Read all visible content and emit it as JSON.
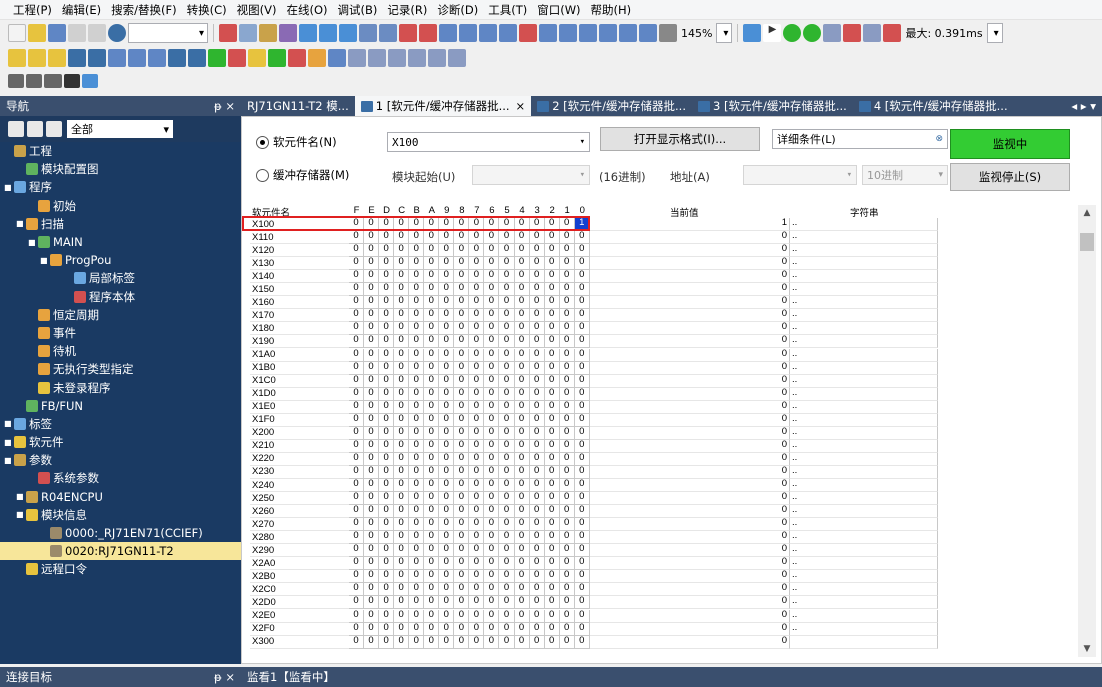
{
  "menu": [
    "工程(P)",
    "编辑(E)",
    "搜索/替换(F)",
    "转换(C)",
    "视图(V)",
    "在线(O)",
    "调试(B)",
    "记录(R)",
    "诊断(D)",
    "工具(T)",
    "窗口(W)",
    "帮助(H)"
  ],
  "toolbar": {
    "zoom": "145%",
    "max_label": "最大: 0.391ms"
  },
  "nav": {
    "title": "导航",
    "pin": "ᵽ ×",
    "filter": "全部",
    "items": [
      {
        "label": "工程",
        "indent": 0,
        "exp": "",
        "icon": "#c9a24a"
      },
      {
        "label": "模块配置图",
        "indent": 1,
        "exp": "",
        "icon": "#5fb35f"
      },
      {
        "label": "程序",
        "indent": 0,
        "exp": "■",
        "icon": "#6aa7e0"
      },
      {
        "label": "初始",
        "indent": 2,
        "exp": "",
        "icon": "#e7a33e"
      },
      {
        "label": "扫描",
        "indent": 1,
        "exp": "■",
        "icon": "#e7a33e"
      },
      {
        "label": "MAIN",
        "indent": 2,
        "exp": "■",
        "icon": "#5fb35f"
      },
      {
        "label": "ProgPou",
        "indent": 3,
        "exp": "■",
        "icon": "#e7a33e"
      },
      {
        "label": "局部标签",
        "indent": 5,
        "exp": "",
        "icon": "#6aa7e0"
      },
      {
        "label": "程序本体",
        "indent": 5,
        "exp": "",
        "icon": "#d35050"
      },
      {
        "label": "恒定周期",
        "indent": 2,
        "exp": "",
        "icon": "#e7a33e"
      },
      {
        "label": "事件",
        "indent": 2,
        "exp": "",
        "icon": "#e7a33e"
      },
      {
        "label": "待机",
        "indent": 2,
        "exp": "",
        "icon": "#e7a33e"
      },
      {
        "label": "无执行类型指定",
        "indent": 2,
        "exp": "",
        "icon": "#e7a33e"
      },
      {
        "label": "未登录程序",
        "indent": 2,
        "exp": "",
        "icon": "#e7c33e"
      },
      {
        "label": "FB/FUN",
        "indent": 1,
        "exp": "",
        "icon": "#5fb35f"
      },
      {
        "label": "标签",
        "indent": 0,
        "exp": "■",
        "icon": "#6aa7e0"
      },
      {
        "label": "软元件",
        "indent": 0,
        "exp": "■",
        "icon": "#e7c33e"
      },
      {
        "label": "参数",
        "indent": 0,
        "exp": "■",
        "icon": "#c9a24a"
      },
      {
        "label": "系统参数",
        "indent": 2,
        "exp": "",
        "icon": "#d35050"
      },
      {
        "label": "R04ENCPU",
        "indent": 1,
        "exp": "■",
        "icon": "#c9a24a"
      },
      {
        "label": "模块信息",
        "indent": 1,
        "exp": "■",
        "icon": "#e7c33e"
      },
      {
        "label": "0000:_RJ71EN71(CCIEF)",
        "indent": 3,
        "exp": "",
        "icon": "#9b8a6a"
      },
      {
        "label": "0020:RJ71GN11-T2",
        "indent": 3,
        "exp": "",
        "icon": "#9b8a6a",
        "selected": true
      },
      {
        "label": "远程口令",
        "indent": 1,
        "exp": "",
        "icon": "#e7c33e"
      }
    ]
  },
  "tabs": [
    {
      "label": "RJ71GN11-T2 模...",
      "active": false
    },
    {
      "label": "1 [软元件/缓冲存储器批...",
      "active": true,
      "close": "×"
    },
    {
      "label": "2 [软元件/缓冲存储器批...",
      "active": false
    },
    {
      "label": "3 [软元件/缓冲存储器批...",
      "active": false
    },
    {
      "label": "4 [软元件/缓冲存储器批...",
      "active": false
    }
  ],
  "tab_arrows": "◂ ▸ ▾",
  "form": {
    "device_radio": "软元件名(N)",
    "device_value": "X100",
    "buffer_radio": "缓冲存储器(M)",
    "module_start": "模块起始(U)",
    "hex_label": "(16进制)",
    "address_label": "地址(A)",
    "radix_value": "10进制",
    "open_format": "打开显示格式(I)...",
    "detail_cond": "详细条件(L)",
    "monitoring": "监视中",
    "stop_monitor": "监视停止(S)"
  },
  "grid": {
    "col_name": "软元件名",
    "bit_headers": [
      "F",
      "E",
      "D",
      "C",
      "B",
      "A",
      "9",
      "8",
      "7",
      "6",
      "5",
      "4",
      "3",
      "2",
      "1",
      "0"
    ],
    "col_value": "当前值",
    "col_string": "字符串",
    "rows": [
      {
        "name": "X100",
        "value": "1",
        "str": "..",
        "hi": true
      },
      {
        "name": "X110",
        "value": "0",
        "str": ".."
      },
      {
        "name": "X120",
        "value": "0",
        "str": ".."
      },
      {
        "name": "X130",
        "value": "0",
        "str": ".."
      },
      {
        "name": "X140",
        "value": "0",
        "str": ".."
      },
      {
        "name": "X150",
        "value": "0",
        "str": ".."
      },
      {
        "name": "X160",
        "value": "0",
        "str": ".."
      },
      {
        "name": "X170",
        "value": "0",
        "str": ".."
      },
      {
        "name": "X180",
        "value": "0",
        "str": ".."
      },
      {
        "name": "X190",
        "value": "0",
        "str": ".."
      },
      {
        "name": "X1A0",
        "value": "0",
        "str": ".."
      },
      {
        "name": "X1B0",
        "value": "0",
        "str": ".."
      },
      {
        "name": "X1C0",
        "value": "0",
        "str": ".."
      },
      {
        "name": "X1D0",
        "value": "0",
        "str": ".."
      },
      {
        "name": "X1E0",
        "value": "0",
        "str": ".."
      },
      {
        "name": "X1F0",
        "value": "0",
        "str": ".."
      },
      {
        "name": "X200",
        "value": "0",
        "str": ".."
      },
      {
        "name": "X210",
        "value": "0",
        "str": ".."
      },
      {
        "name": "X220",
        "value": "0",
        "str": ".."
      },
      {
        "name": "X230",
        "value": "0",
        "str": ".."
      },
      {
        "name": "X240",
        "value": "0",
        "str": ".."
      },
      {
        "name": "X250",
        "value": "0",
        "str": ".."
      },
      {
        "name": "X260",
        "value": "0",
        "str": ".."
      },
      {
        "name": "X270",
        "value": "0",
        "str": ".."
      },
      {
        "name": "X280",
        "value": "0",
        "str": ".."
      },
      {
        "name": "X290",
        "value": "0",
        "str": ".."
      },
      {
        "name": "X2A0",
        "value": "0",
        "str": ".."
      },
      {
        "name": "X2B0",
        "value": "0",
        "str": ".."
      },
      {
        "name": "X2C0",
        "value": "0",
        "str": ".."
      },
      {
        "name": "X2D0",
        "value": "0",
        "str": ".."
      },
      {
        "name": "X2E0",
        "value": "0",
        "str": ".."
      },
      {
        "name": "X2F0",
        "value": "0",
        "str": ".."
      },
      {
        "name": "X300",
        "value": "0",
        "str": ""
      }
    ]
  },
  "bottom": {
    "left": "连接目标",
    "left_pin": "ᵽ ×",
    "right": "监看1【监看中】"
  }
}
